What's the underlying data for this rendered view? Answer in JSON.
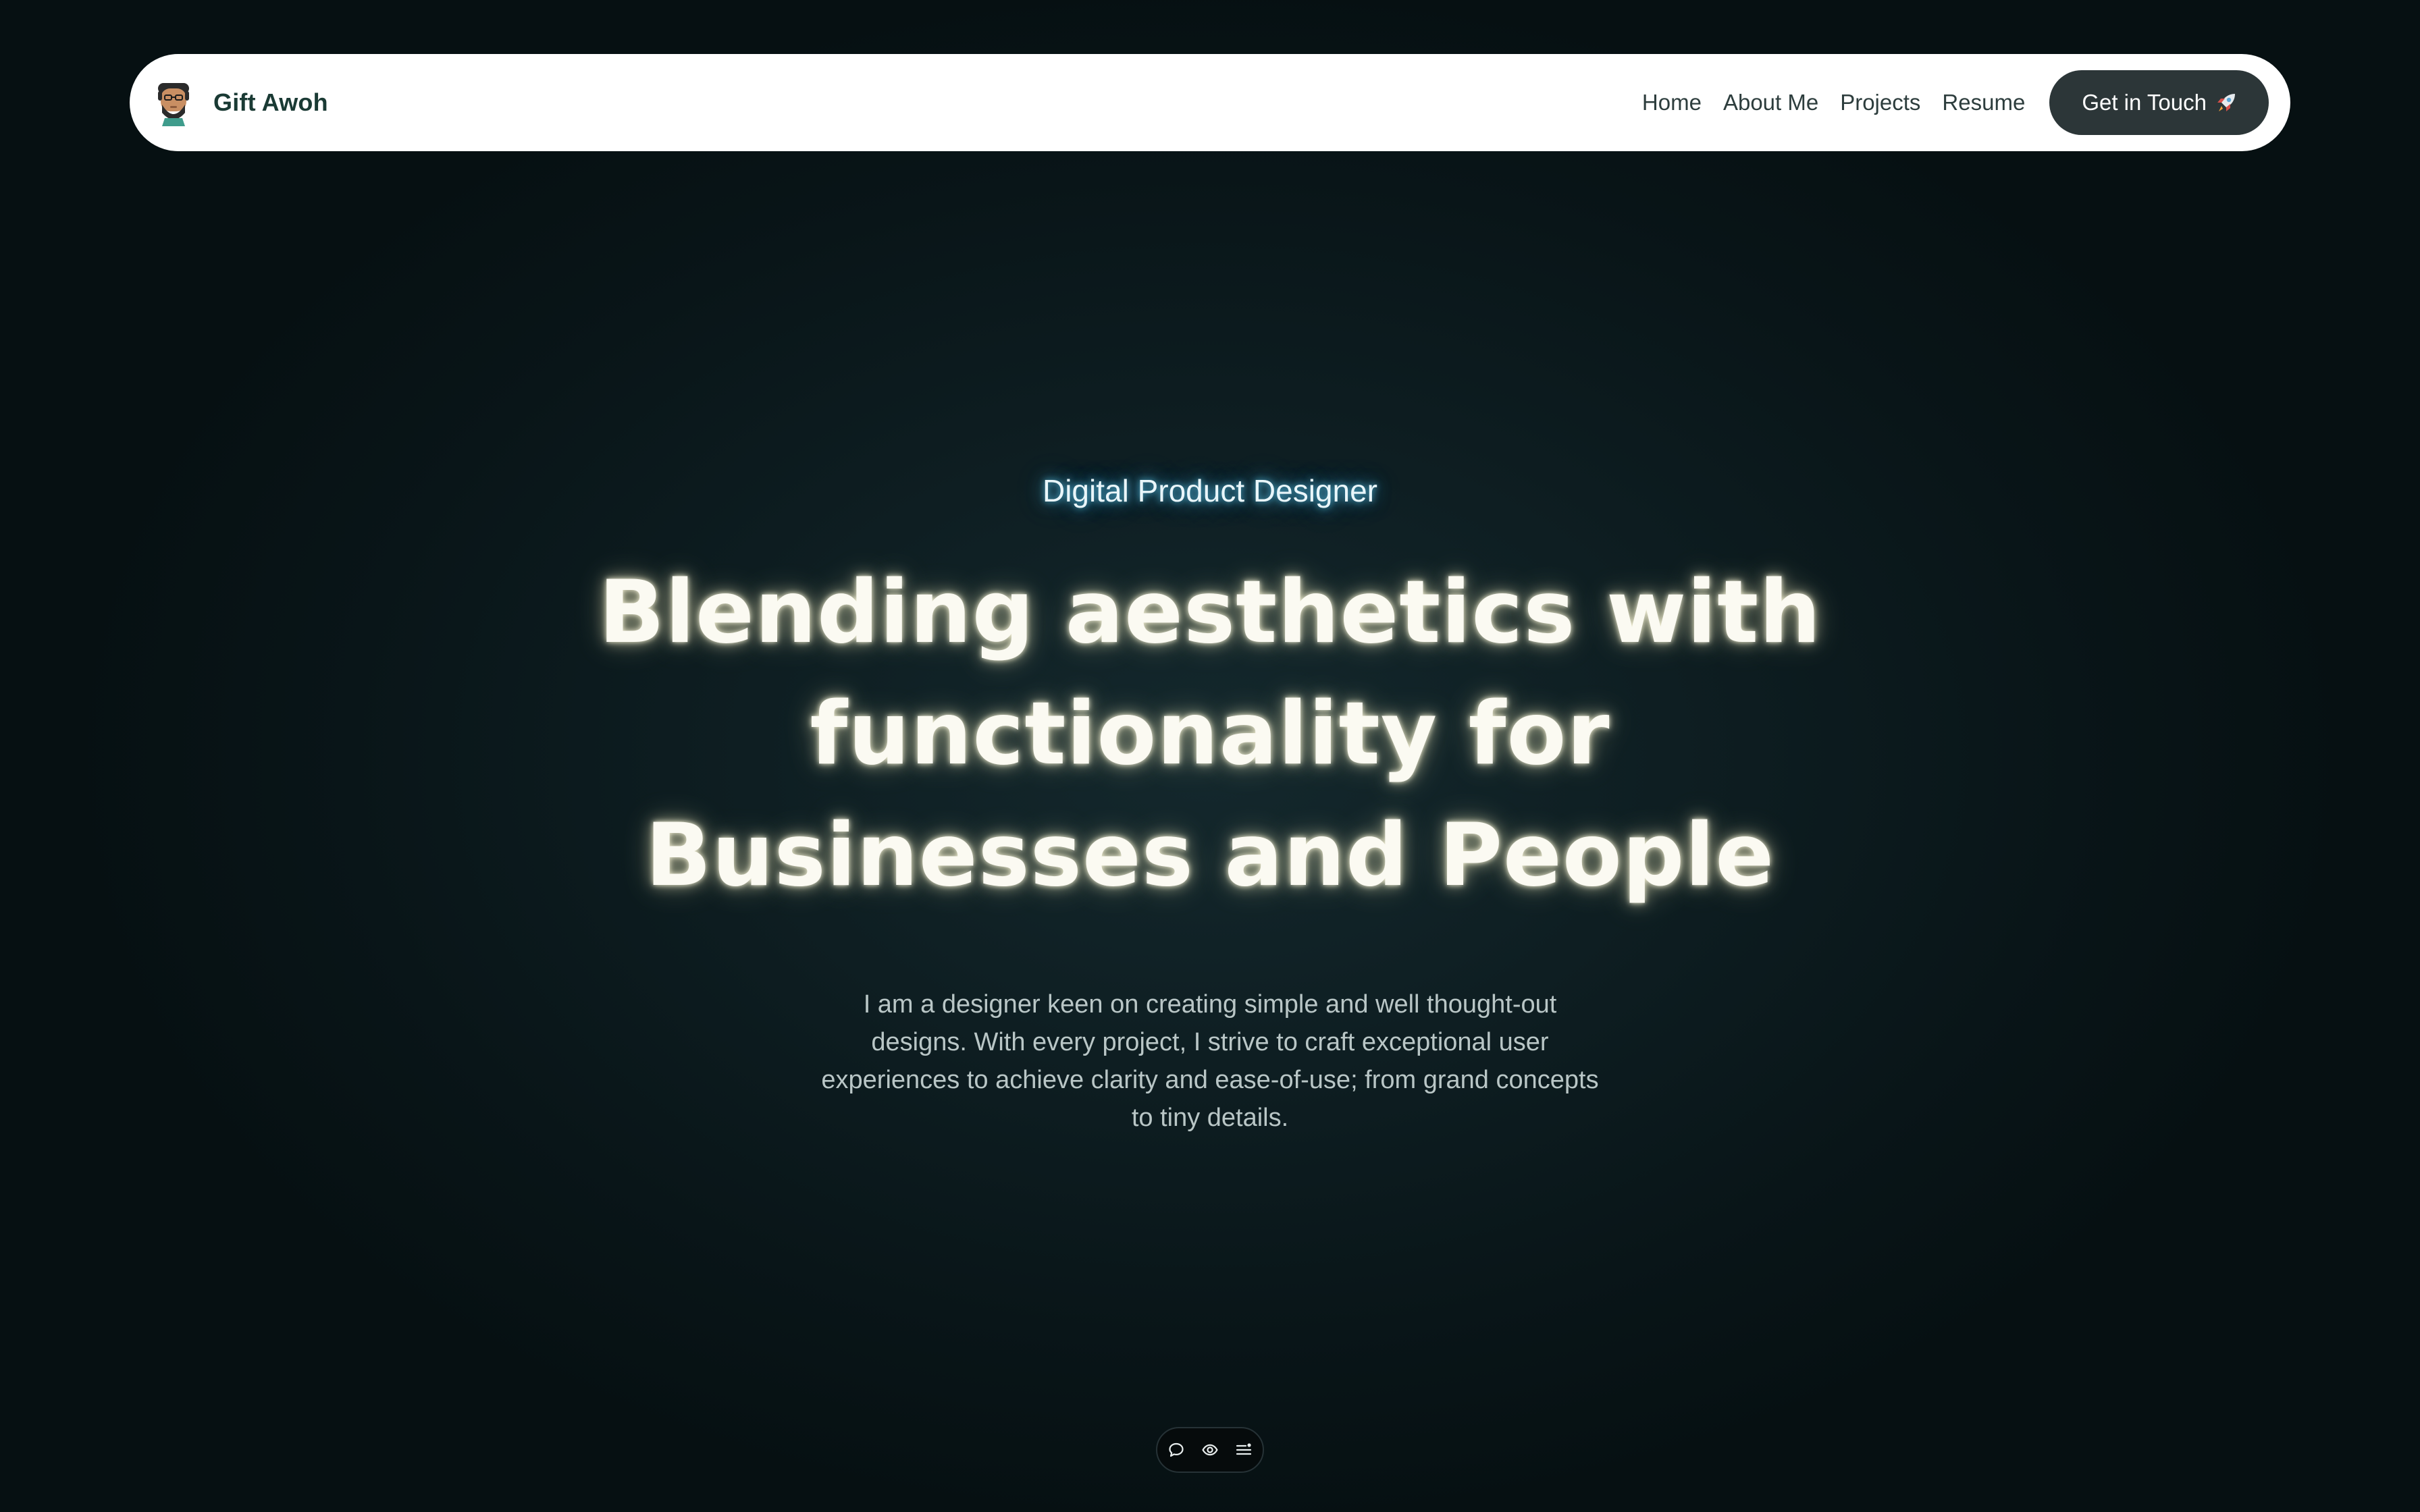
{
  "nav": {
    "brand_name": "Gift Awoh",
    "avatar_icon": "avatar-illustration",
    "links": [
      {
        "label": "Home"
      },
      {
        "label": "About Me"
      },
      {
        "label": "Projects"
      },
      {
        "label": "Resume"
      }
    ],
    "cta_label": "Get in Touch",
    "cta_icon": "rocket-icon"
  },
  "hero": {
    "eyebrow": "Digital Product Designer",
    "headline_lines": [
      "Blending aesthetics with",
      "functionality for",
      "Businesses and People"
    ],
    "intro": "I am a designer keen on creating simple and well thought-out designs. With every project, I strive to craft exceptional user experiences to achieve clarity and ease-of-use; from grand concepts to tiny details."
  },
  "toolbar": {
    "icons": [
      "comment-icon",
      "eye-icon",
      "menu-icon"
    ]
  },
  "colors": {
    "background": "#0e1e22",
    "nav_background": "#ffffff",
    "brand_text": "#1a3a34",
    "cta_background": "#2c3638",
    "eyebrow_glow": "#56c0e4",
    "headline_text": "#fbfaf2",
    "intro_text": "#b9c6c6"
  }
}
